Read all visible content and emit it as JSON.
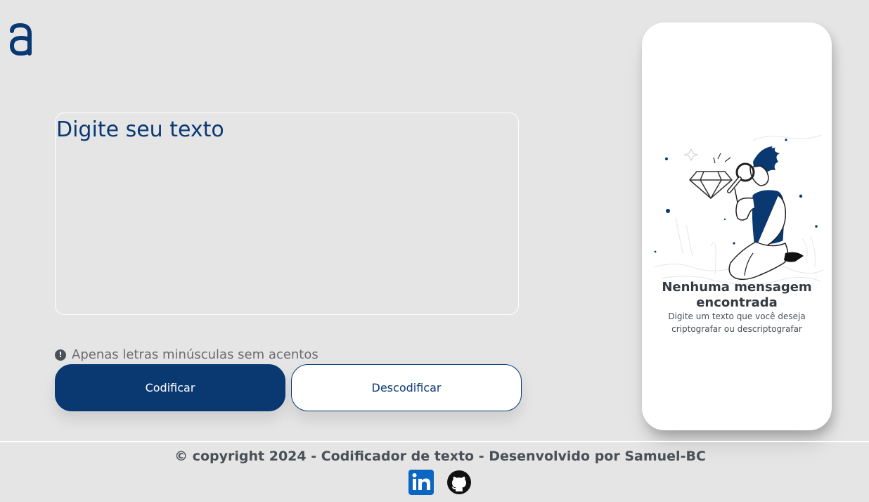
{
  "brand": {
    "logo_icon": "alura-a-logo-icon",
    "color": "#0a3871"
  },
  "input": {
    "placeholder": "Digite seu texto",
    "value": ""
  },
  "hint": {
    "icon": "exclamation-circle-icon",
    "text": "Apenas letras minúsculas sem acentos"
  },
  "actions": {
    "encode_label": "Codificar",
    "decode_label": "Descodificar"
  },
  "output": {
    "illustration": "person-with-magnifying-glass-illustration",
    "title": "Nenhuma mensagem encontrada",
    "subtitle": "Digite um texto que você deseja criptografar ou descriptografar"
  },
  "footer": {
    "text": "© copyright 2024 - Codificador de texto - Desenvolvido por Samuel-BC",
    "links": [
      {
        "name": "linkedin-icon"
      },
      {
        "name": "github-icon"
      }
    ]
  },
  "colors": {
    "background": "#e5e5e6",
    "primary": "#0a3871",
    "panel": "#ffffff",
    "text": "#495057"
  }
}
